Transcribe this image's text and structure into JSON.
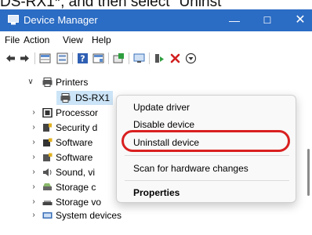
{
  "caption": "DS-RX1*, and then select \"Uninst",
  "window": {
    "title": "Device Manager",
    "minimize_glyph": "—",
    "maximize_glyph": "☐",
    "close_glyph": "✕"
  },
  "menubar": [
    "File",
    "Action",
    "View",
    "Help"
  ],
  "toolbar": {
    "icons": [
      "back-icon",
      "forward-icon",
      "properties-grid-icon",
      "device-list-icon",
      "help-icon",
      "view-icon",
      "update-driver-icon",
      "monitor-icon",
      "enable-device-icon",
      "uninstall-icon",
      "download-icon"
    ],
    "accent_green": "#2e9e3e",
    "accent_red": "#d21f1f"
  },
  "tree": {
    "printers_label": "Printers",
    "selected_device_label": "DS-RX1",
    "categories": [
      "Processor",
      "Security d",
      "Software",
      "Software",
      "Sound, vi",
      "Storage c",
      "Storage vo",
      "System devices"
    ]
  },
  "context_menu": {
    "update_driver": "Update driver",
    "disable_device": "Disable device",
    "uninstall_device": "Uninstall device",
    "scan_hardware": "Scan for hardware changes",
    "properties": "Properties"
  },
  "colors": {
    "titlebar": "#2b6cc4",
    "selection": "#cce4f7",
    "highlight_ring": "#d92020"
  }
}
